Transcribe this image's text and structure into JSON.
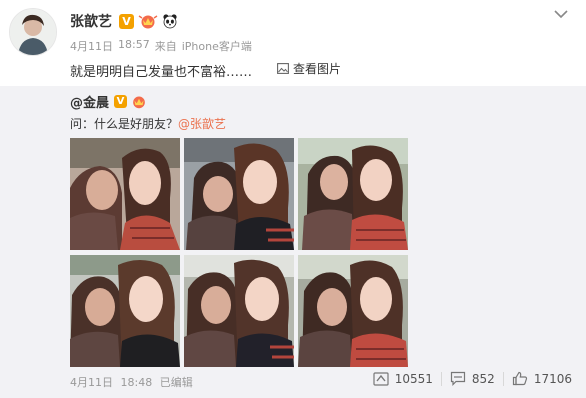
{
  "post": {
    "username": "张歆艺",
    "verified_mark": "V",
    "date": "4月11日",
    "time": "18:57",
    "source_prefix": "来自",
    "source": "iPhone客户端",
    "text": "就是明明自己发量也不富裕……",
    "view_images_label": "查看图片",
    "icons": [
      "chevron-down-icon",
      "crown-badge-icon",
      "panda-badge-icon",
      "image-icon"
    ]
  },
  "repost": {
    "user": "@金晨",
    "verified_mark": "V",
    "text_prefix": "问：什么是好朋友？",
    "mention": "@张歆艺",
    "photos": [
      "photo-1",
      "photo-2",
      "photo-3",
      "photo-4",
      "photo-5",
      "photo-6"
    ],
    "date": "4月11日",
    "time": "18:48",
    "edited_label": "已编辑",
    "reposts": "10551",
    "comments": "852",
    "likes": "17106",
    "icons": [
      "repost-icon",
      "comment-icon",
      "like-icon"
    ]
  },
  "colors": {
    "accent": "#eb7350",
    "verified": "#f4a100",
    "repost_bg": "#f2f2f5"
  }
}
